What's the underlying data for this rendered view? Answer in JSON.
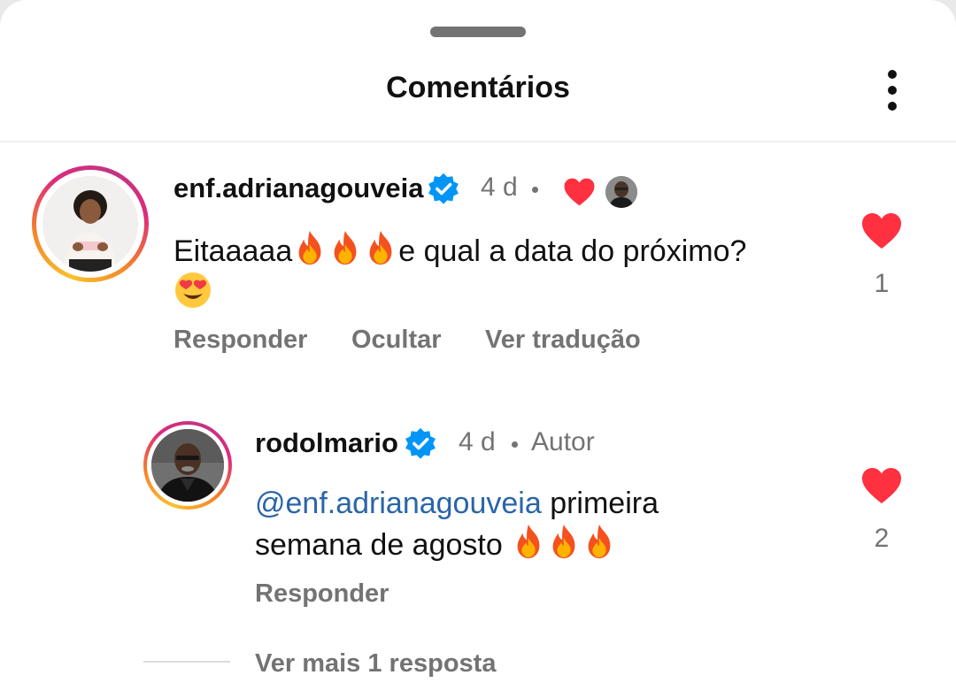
{
  "header": {
    "title": "Comentários"
  },
  "comments": [
    {
      "username": "enf.adrianagouveia",
      "time": "4 d",
      "text": "Eitaaaaa",
      "text_after_emoji": "e qual a data do próximo?",
      "like_count": "1",
      "actions": {
        "reply": "Responder",
        "hide": "Ocultar",
        "translate": "Ver tradução"
      }
    },
    {
      "username": "rodolmario",
      "time": "4 d",
      "author_badge": "Autor",
      "mention": "@enf.adrianagouveia",
      "text_line1": " primeira",
      "text_line2": "semana de agosto ",
      "like_count": "2",
      "actions": {
        "reply": "Responder"
      }
    }
  ],
  "view_more": "Ver mais 1 resposta",
  "colors": {
    "like_red": "#ff3040",
    "verified_blue": "#0095f6",
    "mention_blue": "#2a65a8",
    "muted": "#737373"
  },
  "icons": [
    "verified-badge-icon",
    "heart-icon",
    "fire-emoji",
    "heart-eyes-emoji",
    "more-options-icon"
  ]
}
